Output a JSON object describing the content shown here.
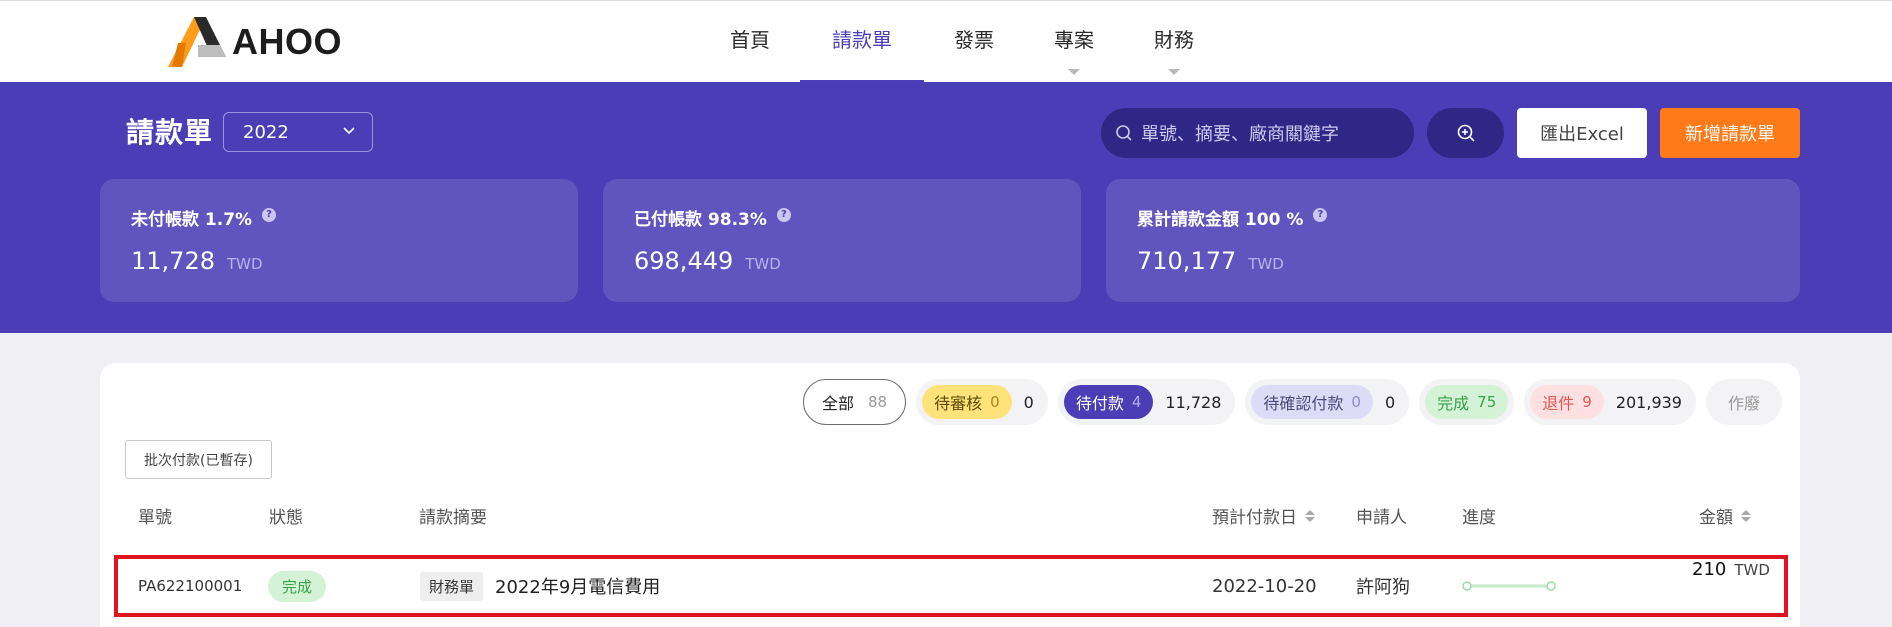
{
  "brand": {
    "name": "AHOO"
  },
  "nav": {
    "items": [
      {
        "label": "首頁"
      },
      {
        "label": "請款單"
      },
      {
        "label": "發票"
      },
      {
        "label": "專案"
      },
      {
        "label": "財務"
      }
    ],
    "active": "請款單"
  },
  "header": {
    "title": "請款單",
    "year": "2022",
    "search_placeholder": "單號、摘要、廠商關鍵字",
    "export_label": "匯出Excel",
    "new_label": "新增請款單"
  },
  "stats": [
    {
      "label": "未付帳款 1.7%",
      "value": "11,728",
      "unit": "TWD"
    },
    {
      "label": "已付帳款 98.3%",
      "value": "698,449",
      "unit": "TWD"
    },
    {
      "label": "累計請款金額 100 %",
      "value": "710,177",
      "unit": "TWD"
    }
  ],
  "filters": {
    "all": {
      "label": "全部",
      "count": "88"
    },
    "pending_review": {
      "label": "待審核",
      "count": "0",
      "amount": "0"
    },
    "to_pay": {
      "label": "待付款",
      "count": "4",
      "amount": "11,728"
    },
    "to_confirm": {
      "label": "待確認付款",
      "count": "0",
      "amount": "0"
    },
    "done": {
      "label": "完成",
      "count": "75"
    },
    "returned": {
      "label": "退件",
      "count": "9",
      "amount": "201,939"
    },
    "void": {
      "label": "作廢"
    }
  },
  "batch_label": "批次付款(已暫存)",
  "table": {
    "columns": {
      "id": "單號",
      "status": "狀態",
      "summary": "請款摘要",
      "due": "預計付款日",
      "applicant": "申請人",
      "progress": "進度",
      "amount": "金額"
    },
    "rows": [
      {
        "id": "PA622100001",
        "status": "完成",
        "tag": "財務單",
        "summary": "2022年9月電信費用",
        "due": "2022-10-20",
        "applicant": "許阿狗",
        "progress": 1.0,
        "amount": "210",
        "unit": "TWD"
      }
    ]
  },
  "colors": {
    "primary": "#4a3db5",
    "accent": "#ff7b1a",
    "success": "#3aa14b",
    "highlight": "#e0141e"
  }
}
